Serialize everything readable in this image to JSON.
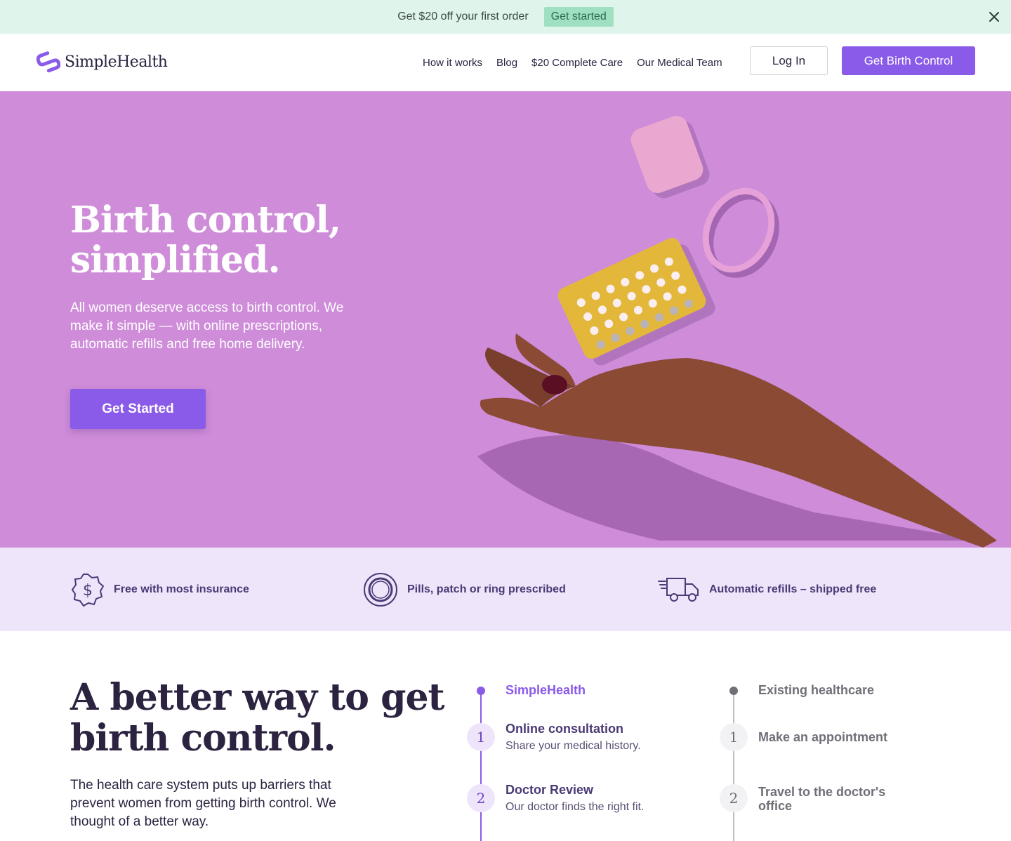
{
  "promo": {
    "text": "Get $20 off your first order",
    "button": "Get started"
  },
  "header": {
    "logo": "SimpleHealth",
    "nav": [
      "How it works",
      "Blog",
      "$20 Complete Care",
      "Our Medical Team"
    ],
    "login": "Log In",
    "cta": "Get Birth Control"
  },
  "hero": {
    "title_line1": "Birth control,",
    "title_line2": "simplified.",
    "subtitle": "All women deserve access to birth control. We make it simple — with online prescriptions, automatic refills and free home delivery.",
    "button": "Get Started"
  },
  "features": [
    {
      "icon": "dollar-badge-icon",
      "label": "Free with most insurance"
    },
    {
      "icon": "pill-ring-icon",
      "label": "Pills, patch or ring prescribed"
    },
    {
      "icon": "delivery-truck-icon",
      "label": "Automatic refills – shipped free"
    }
  ],
  "comparison": {
    "title_line1": "A better way to get",
    "title_line2": "birth control.",
    "subtitle": "The health care system puts up barriers that prevent women from getting birth control. We thought of a better way.",
    "simplehealth": {
      "heading": "SimpleHealth",
      "steps": [
        {
          "num": "1",
          "title": "Online consultation",
          "desc": "Share your medical history."
        },
        {
          "num": "2",
          "title": "Doctor Review",
          "desc": "Our doctor finds the right fit."
        }
      ]
    },
    "existing": {
      "heading": "Existing healthcare",
      "steps": [
        {
          "num": "1",
          "title": "Make an appointment"
        },
        {
          "num": "2",
          "title_line1": "Travel to the doctor's",
          "title_line2": "office"
        }
      ]
    }
  },
  "colors": {
    "accent": "#8a5ae9",
    "hero_bg": "#ce8cd9",
    "promo_bg": "#dff5ec",
    "features_bg": "#efe5fa"
  }
}
